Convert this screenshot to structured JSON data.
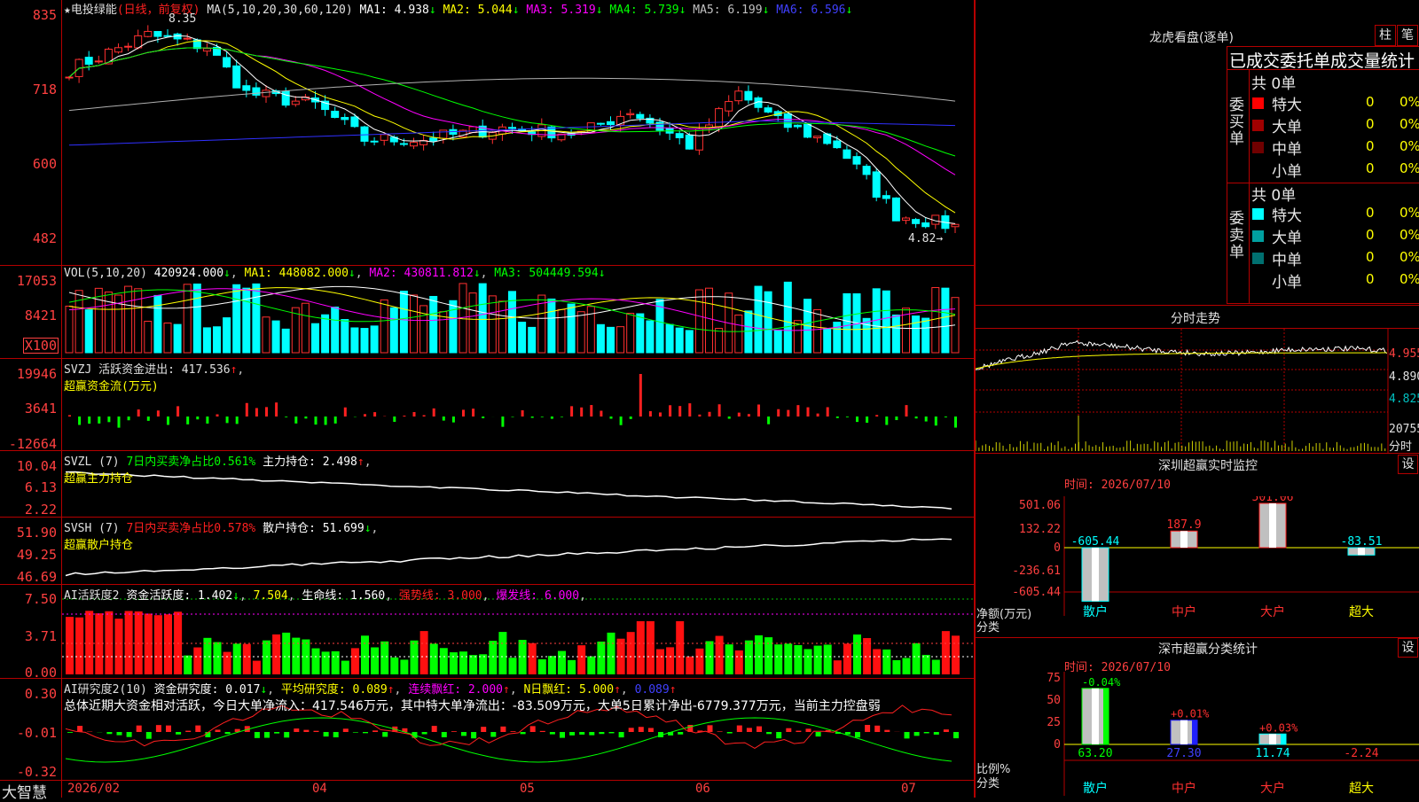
{
  "stock": {
    "star": "★",
    "name": "电投绿能",
    "period": "(日线，前复权)",
    "hi_label": "8.35",
    "lo_label": "4.82"
  },
  "main_ma": {
    "label": "MA(5,10,20,30,60,120)",
    "ma1": "MA1: 4.938",
    "ma2": "MA2: 5.044",
    "ma3": "MA3: 5.319",
    "ma4": "MA4: 5.739",
    "ma5": "MA5: 6.199",
    "ma6": "MA6: 6.596"
  },
  "price_axis": [
    "835",
    "718",
    "600",
    "482"
  ],
  "vol": {
    "label": "VOL(5,10,20)",
    "value": "420924.000",
    "ma1": "MA1: 448082.000",
    "ma2": "MA2: 430811.812",
    "ma3": "MA3: 504449.594",
    "axis": [
      "17053",
      "8421",
      "X100"
    ]
  },
  "svzj": {
    "label": "SVZJ  活跃资金进出: 417.536",
    "sub": "超赢资金流(万元)",
    "axis": [
      "19946",
      "3641",
      "-12664"
    ]
  },
  "svzl": {
    "label": "SVZL (7)",
    "part2": "7日内买卖净占比0.561%",
    "part3": "主力持仓: 2.498",
    "sub": "超赢主力持仓",
    "axis": [
      "10.04",
      "6.13",
      "2.22"
    ]
  },
  "svsh": {
    "label": "SVSH (7)",
    "part2": "7日内买卖净占比0.578%",
    "part3": "散户持仓: 51.699",
    "sub": "超赢散户持仓",
    "axis": [
      "51.90",
      "49.25",
      "46.69"
    ]
  },
  "ai_hyd": {
    "label": "AI活跃度2",
    "p1": "资金活跃度: 1.402",
    "p2": "7.504",
    "p3": "生命线: 1.560",
    "p4": "强势线: 3.000",
    "p5": "爆发线: 6.000",
    "axis": [
      "7.50",
      "3.71",
      "0.00"
    ]
  },
  "ai_yjd": {
    "label": "AI研究度2(10)",
    "p1": "资金研究度: 0.017",
    "p2": "平均研究度: 0.089",
    "p3": "连续飘红: 2.000",
    "p4": "N日飘红: 5.000",
    "p5": "0.089",
    "summary": "总体近期大资金相对活跃，今日大单净流入：417.546万元，其中特大单净流出：-83.509万元，大单5日累计净出-6779.377万元，当前主力控盘弱",
    "axis": [
      "0.30",
      "-0.01",
      "-0.32"
    ]
  },
  "date_axis": {
    "brand": "大智慧",
    "labels": [
      "2026/02",
      "04",
      "05",
      "06",
      "07"
    ]
  },
  "right": {
    "dragon_title": "龙虎看盘(逐单)",
    "btn_zhu": "柱",
    "btn_bi": "笔",
    "stat_title": "已成交委托单成交量统计",
    "buy_label": "委买单",
    "sell_label": "委卖单",
    "buy_total": "共 0单",
    "sell_total": "共 0单",
    "buy_rows": [
      {
        "name": "特大",
        "vol": "0",
        "pct": "0%",
        "color": "#ff0000"
      },
      {
        "name": "大单",
        "vol": "0",
        "pct": "0%",
        "color": "#a00000"
      },
      {
        "name": "中单",
        "vol": "0",
        "pct": "0%",
        "color": "#700000"
      },
      {
        "name": "小单",
        "vol": "0",
        "pct": "0%",
        "color": ""
      }
    ],
    "sell_rows": [
      {
        "name": "特大",
        "vol": "0",
        "pct": "0%",
        "color": "#00ffff"
      },
      {
        "name": "大单",
        "vol": "0",
        "pct": "0%",
        "color": "#00a0a0"
      },
      {
        "name": "中单",
        "vol": "0",
        "pct": "0%",
        "color": "#007070"
      },
      {
        "name": "小单",
        "vol": "0",
        "pct": "0%",
        "color": ""
      }
    ],
    "intraday_title": "分时走势",
    "intraday_axis": [
      "4.955",
      "4.890",
      "4.825",
      "20755",
      "分时"
    ],
    "sz_title": "深圳超赢实时监控",
    "sz_set": "设",
    "sz_time": "时间: 2026/07/10",
    "sz_axis": [
      "501.06",
      "132.22",
      "0",
      "-236.61",
      "-605.44"
    ],
    "sz_net_label": "净额(万元)",
    "sz_class_label": "分类",
    "sz_chart": {
      "type": "bar",
      "categories": [
        "散户",
        "中户",
        "大户",
        "超大"
      ],
      "values": [
        -605.44,
        187.9,
        501.06,
        -83.51
      ],
      "ylim": [
        -605.44,
        501.06
      ]
    },
    "class_title": "深市超赢分类统计",
    "class_set": "设",
    "class_time": "时间: 2026/07/10",
    "class_axis": [
      "75",
      "50",
      "25",
      "0"
    ],
    "class_ratio_label": "比例%",
    "class_class_label": "分类",
    "class_chart": {
      "type": "bar",
      "categories": [
        "散户",
        "中户",
        "大户",
        "超大"
      ],
      "values": [
        63.2,
        27.3,
        11.74,
        -2.24
      ],
      "changes": [
        "-0.04%",
        "+0.01%",
        "+0.03%",
        ""
      ],
      "ylim": [
        0,
        75
      ]
    }
  },
  "colors": {
    "red": "#ff0000",
    "cyan": "#00ffff",
    "green": "#00ff00",
    "frame": "#b40000"
  }
}
